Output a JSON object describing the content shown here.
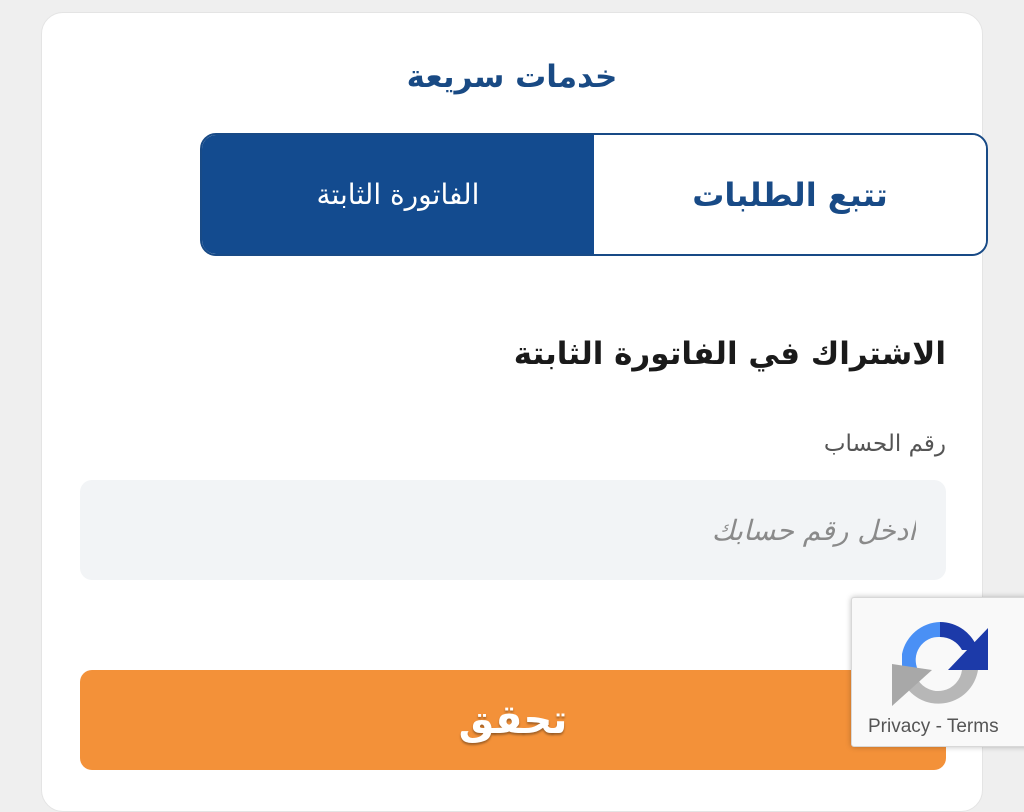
{
  "quick_services": {
    "title": "خدمات سريعة",
    "tabs": [
      {
        "label": "الفاتورة الثابتة",
        "active": true
      },
      {
        "label": "تتبع الطلبات",
        "active": false
      }
    ]
  },
  "form": {
    "heading": "الاشتراك في الفاتورة الثابتة",
    "account_label": "رقم الحساب",
    "account_value": "",
    "account_placeholder": "ادخل رقم حسابك",
    "submit_label": "تحقق"
  },
  "recaptcha": {
    "icon": "recaptcha-icon",
    "privacy_label": "Privacy",
    "separator": "-",
    "terms_label": "Terms"
  },
  "colors": {
    "brand_blue": "#134b8f",
    "accent_orange": "#f39139",
    "input_bg": "#f2f4f6"
  }
}
